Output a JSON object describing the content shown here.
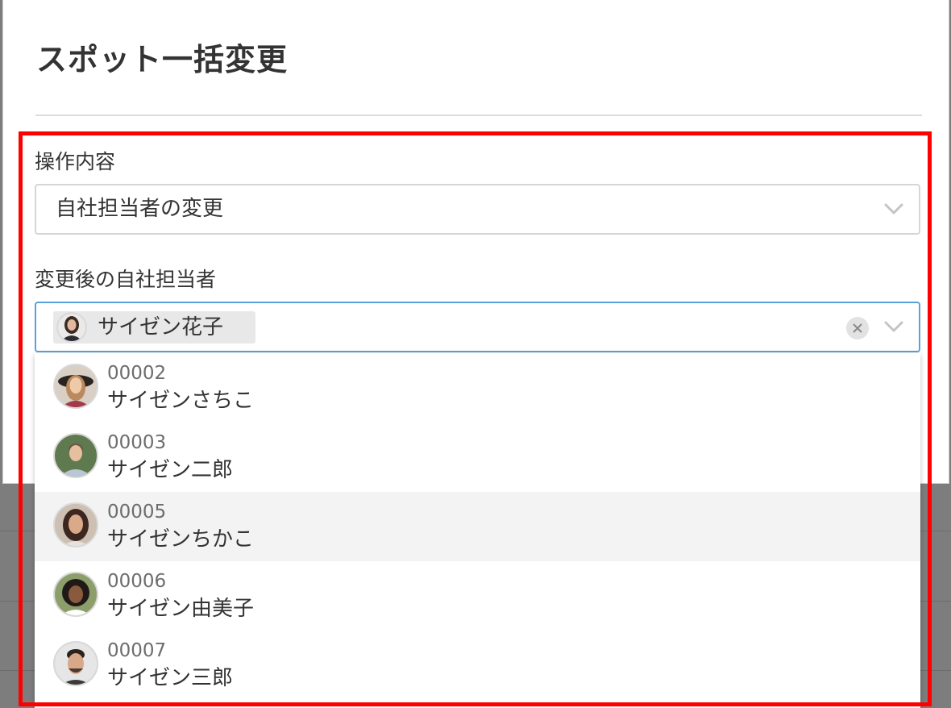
{
  "modal": {
    "title": "スポット一括変更"
  },
  "operation": {
    "label": "操作内容",
    "selected": "自社担当者の変更"
  },
  "assignee": {
    "label": "変更後の自社担当者",
    "selected_name": "サイゼン花子"
  },
  "options": [
    {
      "code": "00002",
      "name": "サイゼンさちこ",
      "highlighted": false
    },
    {
      "code": "00003",
      "name": "サイゼン二郎",
      "highlighted": false
    },
    {
      "code": "00005",
      "name": "サイゼンちかこ",
      "highlighted": true
    },
    {
      "code": "00006",
      "name": "サイゼン由美子",
      "highlighted": false
    },
    {
      "code": "00007",
      "name": "サイゼン三郎",
      "highlighted": false
    }
  ],
  "icons": {
    "dropdown": "chevron-down-icon",
    "clear": "clear-icon"
  },
  "colors": {
    "highlight_box": "#ff0000",
    "focus_border": "#5aa2da",
    "active_option_bg": "#f3f3f3"
  }
}
